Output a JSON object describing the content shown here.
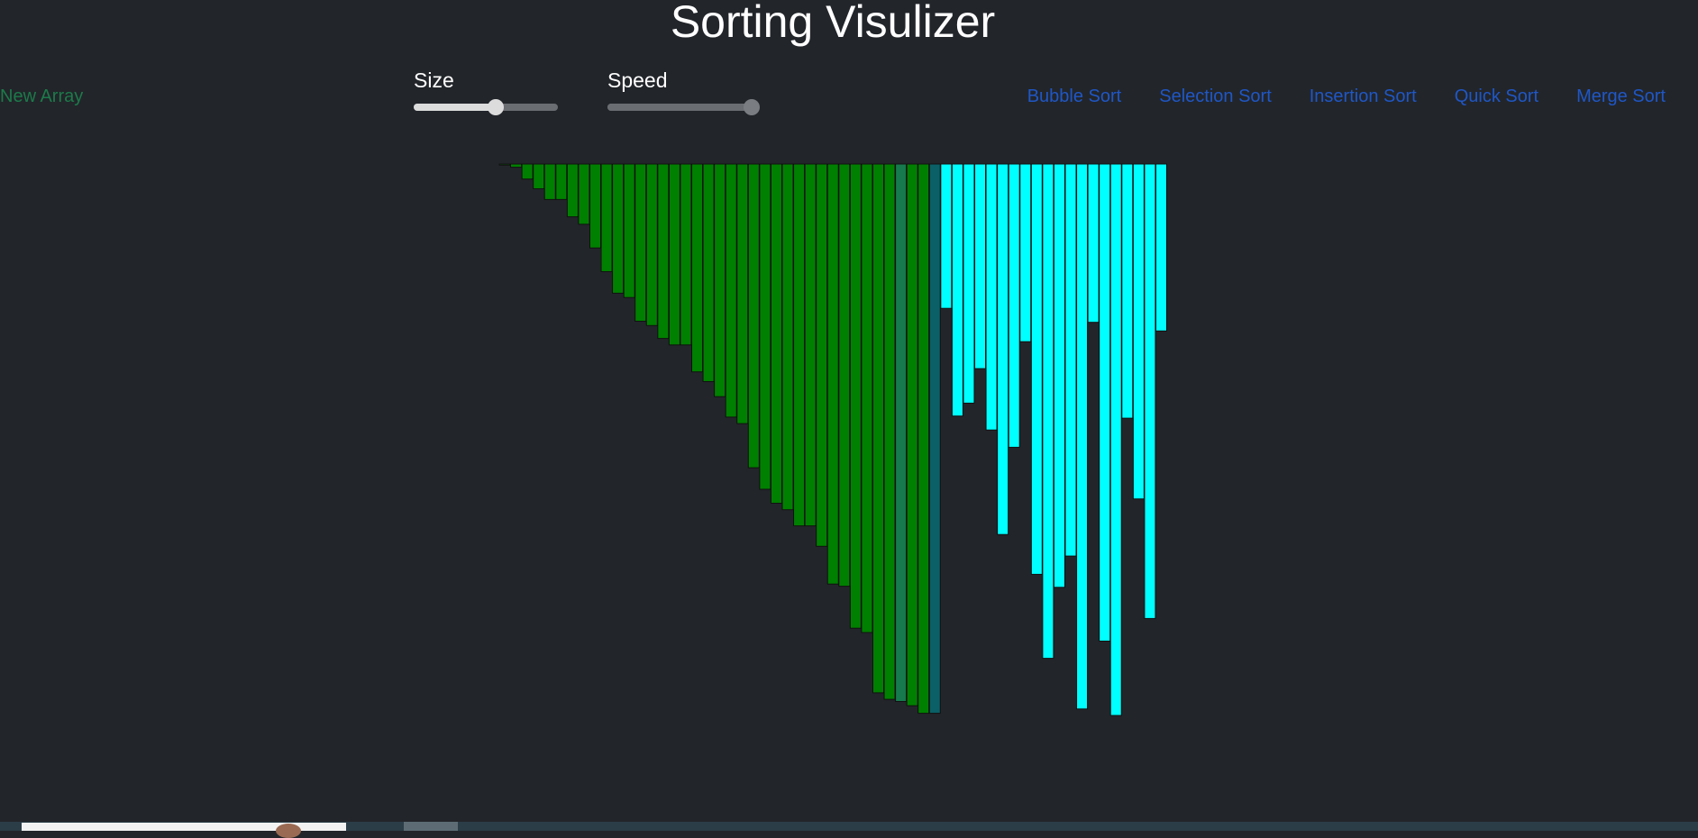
{
  "page": {
    "title": "Sorting Visulizer",
    "background": "#22252a"
  },
  "new_array": {
    "label": "New Array",
    "color": "#1c7a4a"
  },
  "controls": {
    "size": {
      "label": "Size",
      "value_percent": 57
    },
    "speed": {
      "label": "Speed",
      "value_percent": 100
    }
  },
  "algorithms": {
    "color": "#1f57c6",
    "items": [
      {
        "label": "Bubble Sort"
      },
      {
        "label": "Selection Sort"
      },
      {
        "label": "Insertion Sort"
      },
      {
        "label": "Quick Sort"
      },
      {
        "label": "Merge Sort"
      }
    ]
  },
  "array": {
    "colors": {
      "sorted": "#008000",
      "compare": "#167a4e",
      "current": "#0a6066",
      "unsorted": "#00ffff",
      "border": "#111111"
    },
    "max_value": 512,
    "bars": [
      {
        "value": 1,
        "state": "sorted"
      },
      {
        "value": 3,
        "state": "sorted"
      },
      {
        "value": 14,
        "state": "sorted"
      },
      {
        "value": 23,
        "state": "sorted"
      },
      {
        "value": 33,
        "state": "sorted"
      },
      {
        "value": 33,
        "state": "sorted"
      },
      {
        "value": 49,
        "state": "sorted"
      },
      {
        "value": 56,
        "state": "sorted"
      },
      {
        "value": 78,
        "state": "sorted"
      },
      {
        "value": 100,
        "state": "sorted"
      },
      {
        "value": 120,
        "state": "sorted"
      },
      {
        "value": 124,
        "state": "sorted"
      },
      {
        "value": 146,
        "state": "sorted"
      },
      {
        "value": 150,
        "state": "sorted"
      },
      {
        "value": 162,
        "state": "sorted"
      },
      {
        "value": 168,
        "state": "sorted"
      },
      {
        "value": 168,
        "state": "sorted"
      },
      {
        "value": 193,
        "state": "sorted"
      },
      {
        "value": 202,
        "state": "sorted"
      },
      {
        "value": 216,
        "state": "sorted"
      },
      {
        "value": 235,
        "state": "sorted"
      },
      {
        "value": 241,
        "state": "sorted"
      },
      {
        "value": 282,
        "state": "sorted"
      },
      {
        "value": 302,
        "state": "sorted"
      },
      {
        "value": 315,
        "state": "sorted"
      },
      {
        "value": 321,
        "state": "sorted"
      },
      {
        "value": 336,
        "state": "sorted"
      },
      {
        "value": 336,
        "state": "sorted"
      },
      {
        "value": 355,
        "state": "sorted"
      },
      {
        "value": 390,
        "state": "sorted"
      },
      {
        "value": 392,
        "state": "sorted"
      },
      {
        "value": 431,
        "state": "sorted"
      },
      {
        "value": 435,
        "state": "sorted"
      },
      {
        "value": 491,
        "state": "sorted"
      },
      {
        "value": 497,
        "state": "sorted"
      },
      {
        "value": 499,
        "state": "compare"
      },
      {
        "value": 503,
        "state": "sorted"
      },
      {
        "value": 510,
        "state": "sorted"
      },
      {
        "value": 510,
        "state": "current"
      },
      {
        "value": 134,
        "state": "unsorted"
      },
      {
        "value": 234,
        "state": "unsorted"
      },
      {
        "value": 222,
        "state": "unsorted"
      },
      {
        "value": 190,
        "state": "unsorted"
      },
      {
        "value": 247,
        "state": "unsorted"
      },
      {
        "value": 344,
        "state": "unsorted"
      },
      {
        "value": 263,
        "state": "unsorted"
      },
      {
        "value": 165,
        "state": "unsorted"
      },
      {
        "value": 381,
        "state": "unsorted"
      },
      {
        "value": 459,
        "state": "unsorted"
      },
      {
        "value": 393,
        "state": "unsorted"
      },
      {
        "value": 364,
        "state": "unsorted"
      },
      {
        "value": 506,
        "state": "unsorted"
      },
      {
        "value": 147,
        "state": "unsorted"
      },
      {
        "value": 443,
        "state": "unsorted"
      },
      {
        "value": 512,
        "state": "unsorted"
      },
      {
        "value": 236,
        "state": "unsorted"
      },
      {
        "value": 311,
        "state": "unsorted"
      },
      {
        "value": 422,
        "state": "unsorted"
      },
      {
        "value": 155,
        "state": "unsorted"
      }
    ]
  }
}
